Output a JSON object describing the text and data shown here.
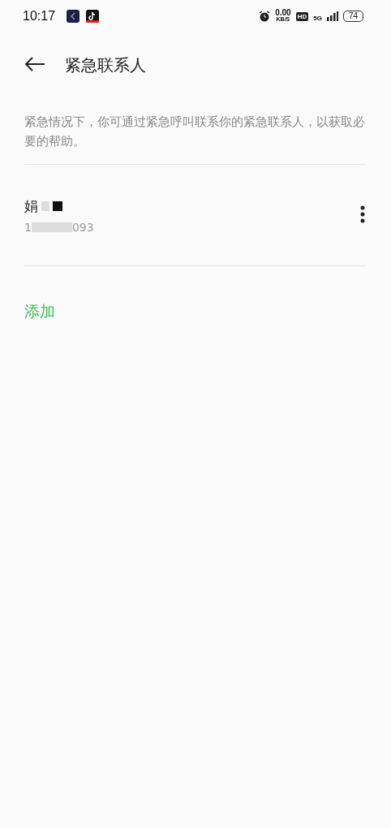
{
  "status_bar": {
    "time": "10:17",
    "net_speed_value": "0.00",
    "net_speed_unit": "KB/S",
    "hd_label": "HD",
    "network_label": "5G",
    "battery": "74"
  },
  "header": {
    "title": "紧急联系人"
  },
  "description": "紧急情况下，你可通过紧急呼叫联系你的紧急联系人，以获取必要的帮助。",
  "contacts": [
    {
      "name": "娟",
      "phone_start": "1",
      "phone_end": "093"
    }
  ],
  "add_label": "添加"
}
